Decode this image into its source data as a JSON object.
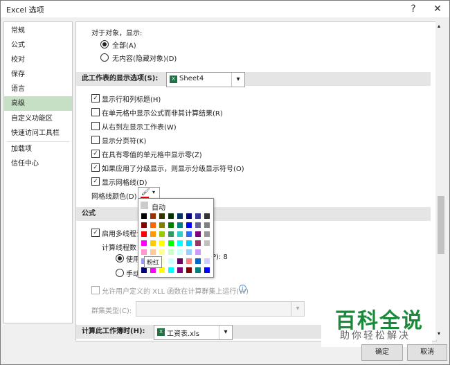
{
  "window": {
    "title": "Excel 选项",
    "help": "?",
    "close": "✕"
  },
  "nav": [
    "常规",
    "公式",
    "校对",
    "保存",
    "语言",
    "高级",
    "自定义功能区",
    "快速访问工具栏",
    "加载项",
    "信任中心"
  ],
  "objects": {
    "heading": "对于对象，显示:",
    "all": "全部(A)",
    "none": "无内容(隐藏对象)(D)"
  },
  "sheet_section": {
    "label": "此工作表的显示选项(S):",
    "selected": "Sheet4"
  },
  "sheet_options": [
    {
      "label": "显示行和列标题(H)",
      "checked": true
    },
    {
      "label": "在单元格中显示公式而非其计算结果(R)",
      "checked": false
    },
    {
      "label": "从右到左显示工作表(W)",
      "checked": false
    },
    {
      "label": "显示分页符(K)",
      "checked": false
    },
    {
      "label": "在具有零值的单元格中显示零(Z)",
      "checked": true
    },
    {
      "label": "如果应用了分级显示，则显示分级显示符号(O)",
      "checked": true
    },
    {
      "label": "显示网格线(D)",
      "checked": true
    }
  ],
  "gridline_color": {
    "label": "网格线颜色(D)",
    "value": "粉红"
  },
  "palette": {
    "auto_label": "自动",
    "tooltip": "粉红",
    "rows": [
      [
        "#000000",
        "#993300",
        "#333300",
        "#003300",
        "#003366",
        "#000080",
        "#333399",
        "#333333"
      ],
      [
        "#800000",
        "#ff6600",
        "#808000",
        "#008000",
        "#008080",
        "#0000ff",
        "#666699",
        "#808080"
      ],
      [
        "#ff0000",
        "#ff9900",
        "#99cc00",
        "#339966",
        "#33cccc",
        "#3366ff",
        "#800080",
        "#969696"
      ],
      [
        "#ff00ff",
        "#ffcc00",
        "#ffff00",
        "#00ff00",
        "#00ffff",
        "#00ccff",
        "#993366",
        "#c0c0c0"
      ],
      [
        "#ff99cc",
        "#ffcc99",
        "#ffff99",
        "#ccffcc",
        "#ccffff",
        "#99ccff",
        "#cc99ff",
        "#ffffff"
      ],
      [
        "#9999ff",
        "#993366",
        "#ffffcc",
        "#ccffff",
        "#660066",
        "#ff8080",
        "#0066cc",
        "#ccccff"
      ],
      [
        "#000080",
        "#ff00ff",
        "#ffff00",
        "#00ffff",
        "#800080",
        "#800000",
        "#008080",
        "#0000ff"
      ]
    ]
  },
  "formula_section": {
    "title": "公式",
    "multithread": "启用多线程计",
    "thread_count": "计算线程数",
    "use_all": "使用",
    "use_all_value": "P): 8",
    "manual": "手动",
    "xll": "允许用户定义的 XLL 函数在计算群集上运行(W)",
    "cluster_type": "群集类型(C):"
  },
  "workbook_section": {
    "label": "计算此工作簿时(H):",
    "selected": "工资表.xls"
  },
  "buttons": {
    "ok": "确定",
    "cancel": "取消"
  },
  "watermark": {
    "main": "百科全说",
    "sub": "助你轻松解决"
  }
}
